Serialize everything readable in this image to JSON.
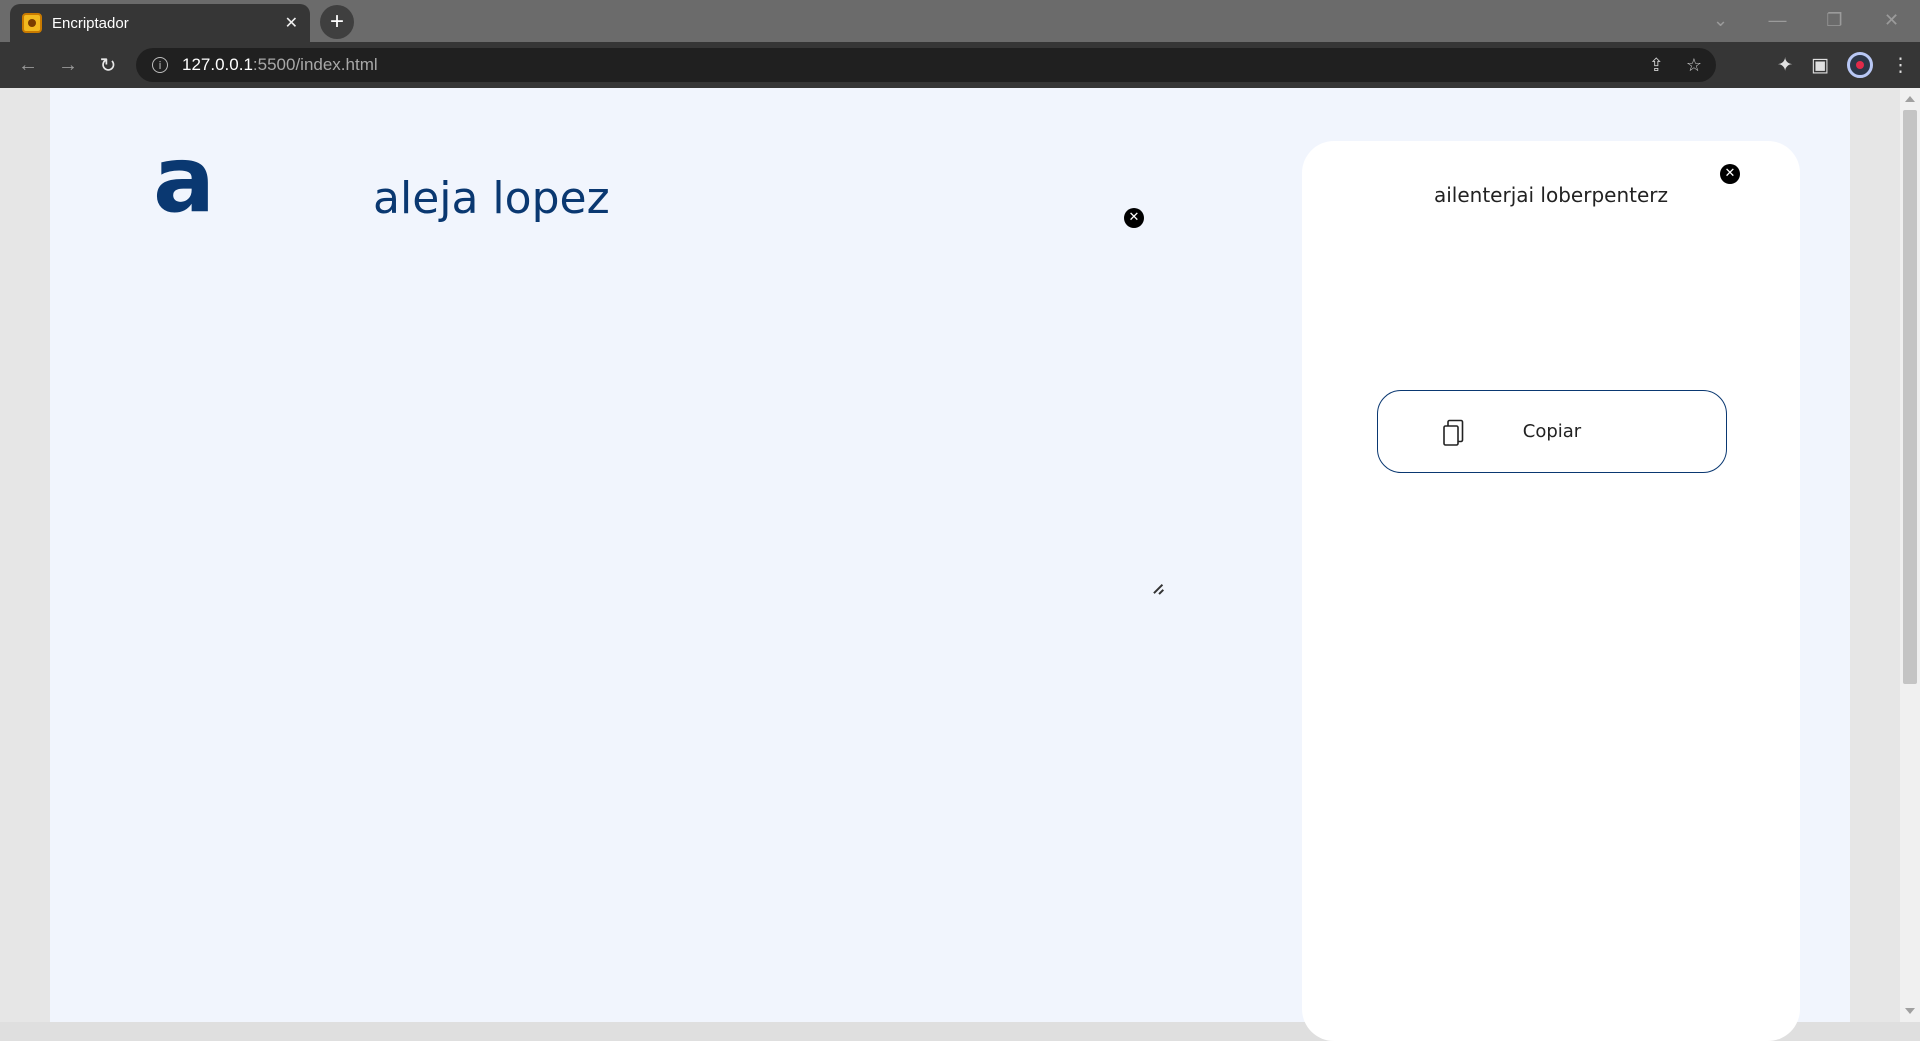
{
  "browser": {
    "tab_title": "Encriptador",
    "url_host": "127.0.0.1",
    "url_path": ":5500/index.html"
  },
  "page": {
    "logo_letter": "a",
    "input_text": "aleja lopez",
    "output_text": "ailenterjai loberpenterz",
    "copy_label": "Copiar"
  },
  "colors": {
    "page_background": "#f1f5fd",
    "brand_blue": "#0a3871",
    "card_background": "#ffffff"
  },
  "icons": {
    "clear": "circle-x-icon",
    "copy": "copy-icon"
  }
}
